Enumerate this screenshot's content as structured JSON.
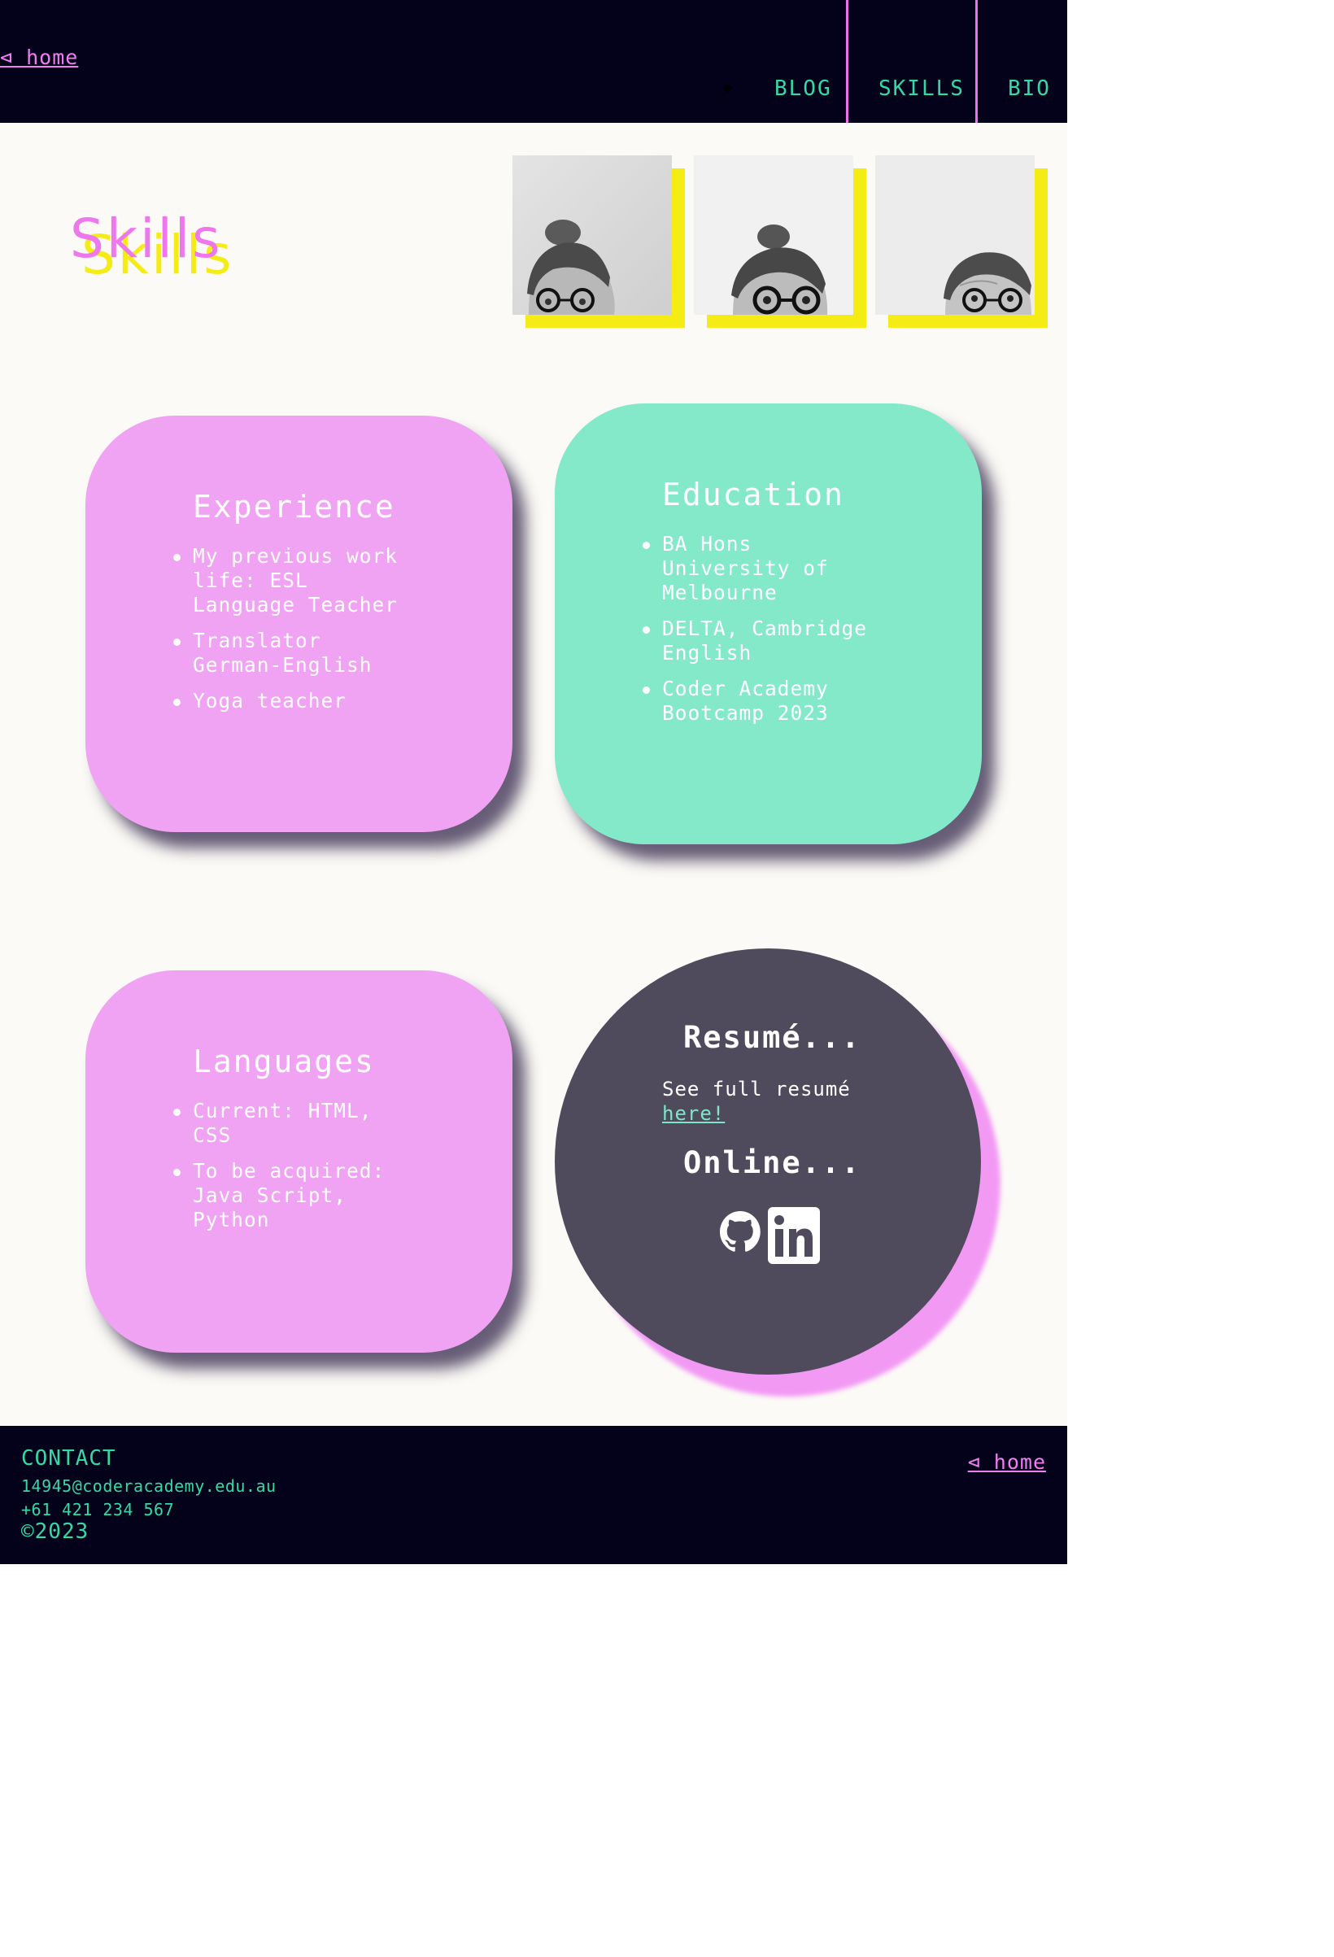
{
  "header": {
    "home_label": "⊲ home",
    "nav": [
      {
        "label": "BLOG"
      },
      {
        "label": "SKILLS"
      },
      {
        "label": "BIO"
      }
    ]
  },
  "main": {
    "title": "Skills",
    "photos": [
      "portrait-photo",
      "portrait-photo",
      "portrait-photo"
    ],
    "cards": {
      "experience": {
        "heading": "Experience",
        "items": [
          "My previous work life: ESL Language Teacher",
          "Translator German-English",
          "Yoga teacher"
        ]
      },
      "education": {
        "heading": "Education",
        "items": [
          "BA Hons University of Melbourne",
          "DELTA, Cambridge English",
          "Coder Academy Bootcamp 2023"
        ]
      },
      "languages": {
        "heading": "Languages",
        "items": [
          "Current: HTML, CSS",
          "To be acquired: Java Script, Python"
        ]
      }
    },
    "resume": {
      "heading": "Resumé...",
      "text": "See full resumé",
      "link_label": "here!",
      "online_heading": "Online...",
      "icons": [
        "github-icon",
        "linkedin-icon"
      ]
    }
  },
  "footer": {
    "contact_title": "CONTACT",
    "email": "14945@coderacademy.edu.au",
    "phone": "+61 421 234 567",
    "copyright": "©2023",
    "home_label": "⊲ home"
  },
  "colors": {
    "navy": "#04021b",
    "pink": "#f1a3f3",
    "green": "#84e9c9",
    "yellow": "#f5ec15",
    "teal_text": "#35d9a6",
    "magenta_link": "#f07ef0",
    "circle": "#4f4b5d"
  }
}
